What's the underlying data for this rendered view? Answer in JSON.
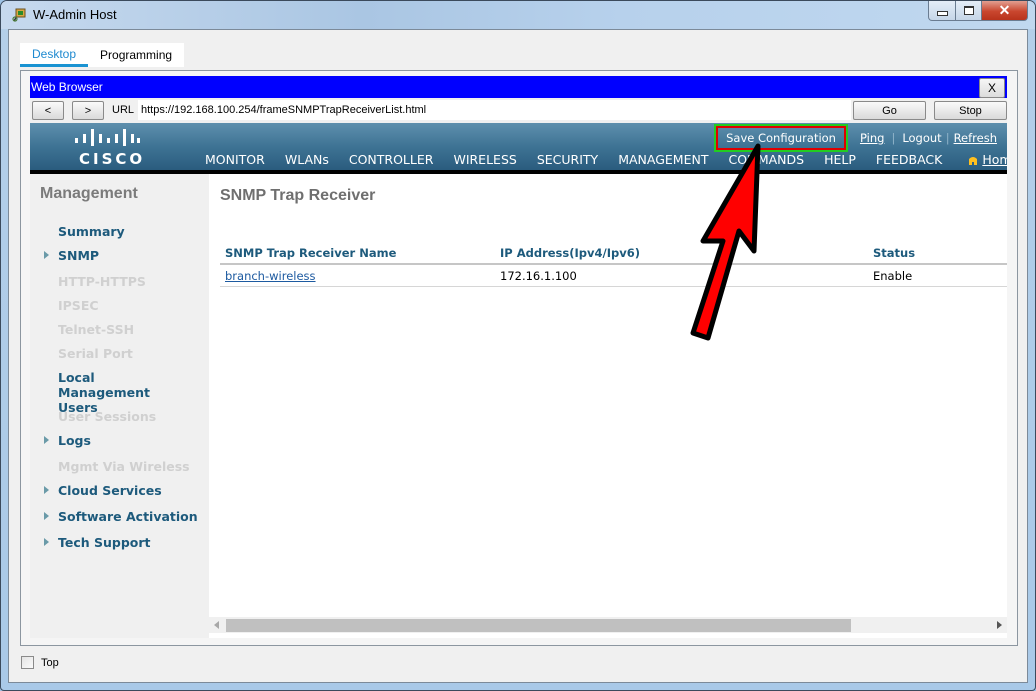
{
  "window": {
    "title": "W-Admin Host",
    "controls": {
      "minimize": "minimize",
      "maximize": "maximize",
      "close": "✕"
    }
  },
  "tabs": [
    {
      "label": "Desktop",
      "active": true
    },
    {
      "label": "Programming",
      "active": false
    }
  ],
  "browser": {
    "title": "Web Browser",
    "close_label": "X",
    "back_label": "<",
    "forward_label": ">",
    "url_label": "URL",
    "url_value": "https://192.168.100.254/frameSNMPTrapReceiverList.html",
    "go_label": "Go",
    "stop_label": "Stop"
  },
  "cisco": {
    "logo_text": "CISCO",
    "top_links": {
      "save_configuration": "Save Configuration",
      "ping": "Ping",
      "logout": "Logout",
      "refresh": "Refresh",
      "separator": "|"
    },
    "main_nav": [
      {
        "label": "MONITOR",
        "active": false
      },
      {
        "label": "WLANs",
        "active": false
      },
      {
        "label": "CONTROLLER",
        "active": false
      },
      {
        "label": "WIRELESS",
        "active": false
      },
      {
        "label": "SECURITY",
        "active": false
      },
      {
        "label": "MANAGEMENT",
        "active": true
      },
      {
        "label": "COMMANDS",
        "active": false
      },
      {
        "label": "HELP",
        "active": false
      },
      {
        "label": "FEEDBACK",
        "active": false
      }
    ],
    "home_label": "Home",
    "accent_color": "#f39000",
    "highlight_colors": {
      "outer": "#22cc22",
      "inner": "#e00000"
    }
  },
  "sidebar": {
    "title": "Management",
    "items": [
      {
        "label": "Summary",
        "enabled": true,
        "expandable": false
      },
      {
        "label": "SNMP",
        "enabled": true,
        "expandable": true
      },
      {
        "label": "HTTP-HTTPS",
        "enabled": false,
        "expandable": false
      },
      {
        "label": "IPSEC",
        "enabled": false,
        "expandable": false
      },
      {
        "label": "Telnet-SSH",
        "enabled": false,
        "expandable": false
      },
      {
        "label": "Serial Port",
        "enabled": false,
        "expandable": false
      },
      {
        "label": "Local Management Users",
        "enabled": true,
        "expandable": false
      },
      {
        "label": "User Sessions",
        "enabled": false,
        "expandable": false
      },
      {
        "label": "Logs",
        "enabled": true,
        "expandable": true
      },
      {
        "label": "Mgmt Via Wireless",
        "enabled": false,
        "expandable": false
      },
      {
        "label": "Cloud Services",
        "enabled": true,
        "expandable": true
      },
      {
        "label": "Software Activation",
        "enabled": true,
        "expandable": true
      },
      {
        "label": "Tech Support",
        "enabled": true,
        "expandable": true
      }
    ]
  },
  "content": {
    "title": "SNMP Trap Receiver",
    "table": {
      "columns": [
        "SNMP Trap Receiver Name",
        "IP Address(Ipv4/Ipv6)",
        "Status"
      ],
      "rows": [
        {
          "name": "branch-wireless",
          "ip": "172.16.1.100",
          "status": "Enable"
        }
      ]
    }
  },
  "footer": {
    "top_checkbox_label": "Top",
    "top_checked": false
  }
}
